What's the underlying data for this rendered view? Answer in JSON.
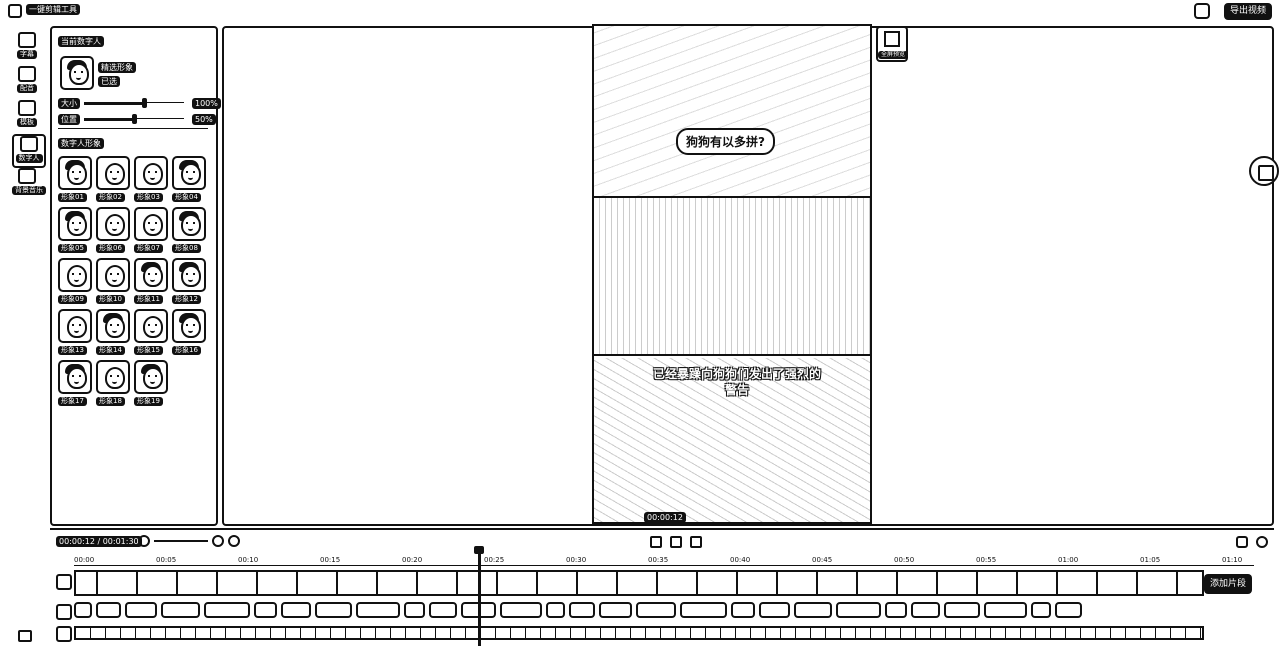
{
  "app": {
    "title": "一键剪辑工具",
    "export_label": "导出视频"
  },
  "rail": {
    "items": [
      {
        "label": "字幕",
        "icon": "text-icon"
      },
      {
        "label": "配音",
        "icon": "mic-icon"
      },
      {
        "label": "模板",
        "icon": "template-icon"
      },
      {
        "label": "数字人",
        "icon": "avatar-icon"
      },
      {
        "label": "背景音乐",
        "icon": "music-icon"
      }
    ],
    "active_index": 3
  },
  "panel": {
    "current_title": "当前数字人",
    "current_name": "精选形象",
    "current_tag": "已选",
    "sliders": [
      {
        "label": "大小",
        "value": "100%",
        "level": 0.6
      },
      {
        "label": "位置",
        "value": "50%",
        "level": 0.5
      }
    ],
    "library_title": "数字人形象",
    "avatars": [
      {
        "label": "形象01",
        "hair": true
      },
      {
        "label": "形象02",
        "hair": false
      },
      {
        "label": "形象03",
        "hair": false
      },
      {
        "label": "形象04",
        "hair": true
      },
      {
        "label": "形象05",
        "hair": true
      },
      {
        "label": "形象06",
        "hair": false
      },
      {
        "label": "形象07",
        "hair": false
      },
      {
        "label": "形象08",
        "hair": true
      },
      {
        "label": "形象09",
        "hair": false
      },
      {
        "label": "形象10",
        "hair": false
      },
      {
        "label": "形象11",
        "hair": true
      },
      {
        "label": "形象12",
        "hair": true
      },
      {
        "label": "形象13",
        "hair": false
      },
      {
        "label": "形象14",
        "hair": true
      },
      {
        "label": "形象15",
        "hair": false
      },
      {
        "label": "形象16",
        "hair": true
      },
      {
        "label": "形象17",
        "hair": true
      },
      {
        "label": "形象18",
        "hair": false
      },
      {
        "label": "形象19",
        "hair": true
      }
    ]
  },
  "preview": {
    "caption_top": "狗狗有以多拼?",
    "caption_bottom": "已经暴躁向狗狗们发出了强烈的警告",
    "fullscreen_label": "全屏预览",
    "time": "00:00:12"
  },
  "timeline": {
    "zoom_label": "00:00:12 / 00:01:30",
    "ruler": [
      "00:00",
      "00:05",
      "00:10",
      "00:15",
      "00:20",
      "00:25",
      "00:30",
      "00:35",
      "00:40",
      "00:45",
      "00:50",
      "00:55",
      "01:00",
      "01:05",
      "01:10"
    ],
    "add_track_label": "添加片段",
    "audio_clip_count": 28
  }
}
